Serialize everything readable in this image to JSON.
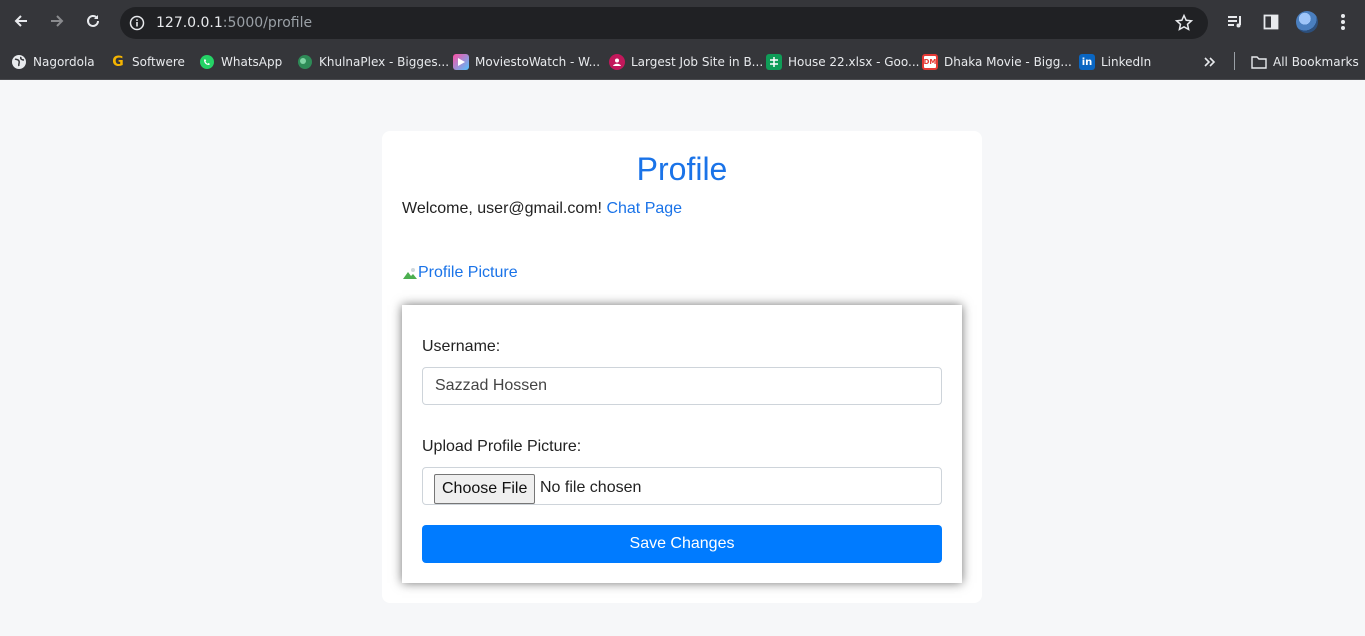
{
  "browser": {
    "url_host": "127.0.0.1",
    "url_path": ":5000/profile",
    "bookmarks": [
      {
        "label": "Nagordola",
        "icon": "globe-icon"
      },
      {
        "label": "Softwere",
        "icon": "g-icon"
      },
      {
        "label": "WhatsApp",
        "icon": "whatsapp-icon"
      },
      {
        "label": "KhulnaPlex - Bigges...",
        "icon": "khulnaplex-icon"
      },
      {
        "label": "MoviestoWatch - W...",
        "icon": "play-icon"
      },
      {
        "label": "Largest Job Site in B...",
        "icon": "job-icon"
      },
      {
        "label": "House 22.xlsx - Goo...",
        "icon": "sheets-icon"
      },
      {
        "label": "Dhaka Movie - Bigg...",
        "icon": "dhaka-movie-icon"
      },
      {
        "label": "LinkedIn",
        "icon": "linkedin-icon"
      }
    ],
    "all_bookmarks_label": "All Bookmarks",
    "bookmark_glyphs": {
      "g": "G",
      "linkedin": "in",
      "dhaka": "DM"
    }
  },
  "page": {
    "title": "Profile",
    "welcome_text": "Welcome, user@gmail.com!",
    "chat_link": "Chat Page",
    "profile_picture_alt": "Profile Picture"
  },
  "form": {
    "username_label": "Username:",
    "username_value": "Sazzad Hossen",
    "upload_label": "Upload Profile Picture:",
    "choose_file_label": "Choose File",
    "no_file_text": "No file chosen",
    "save_label": "Save Changes"
  },
  "colors": {
    "accent": "#1a73e8",
    "button": "#007bff"
  }
}
